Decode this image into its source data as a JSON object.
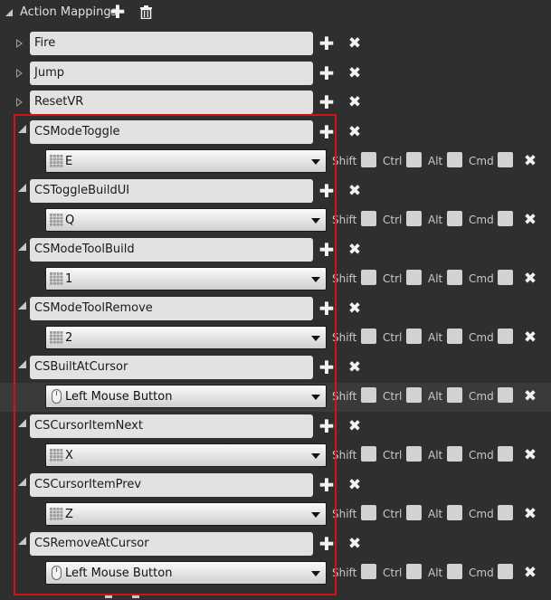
{
  "header": {
    "title": "Action Mappings",
    "add_icon": "plus-icon",
    "delete_icon": "trash-icon"
  },
  "modifier_labels": {
    "shift": "Shift",
    "ctrl": "Ctrl",
    "alt": "Alt",
    "cmd": "Cmd"
  },
  "colors": {
    "background": "#2f2f2f",
    "name_field": "#e2e2e2",
    "highlight_box": "#d0141a"
  },
  "collapsed_mappings": [
    {
      "name": "Fire"
    },
    {
      "name": "Jump"
    },
    {
      "name": "ResetVR"
    }
  ],
  "mappings": [
    {
      "name": "CSModeToggle",
      "key": "E",
      "key_icon": "keyboard-icon"
    },
    {
      "name": "CSToggleBuildUI",
      "key": "Q",
      "key_icon": "keyboard-icon"
    },
    {
      "name": "CSModeToolBuild",
      "key": "1",
      "key_icon": "keyboard-icon"
    },
    {
      "name": "CSModeToolRemove",
      "key": "2",
      "key_icon": "keyboard-icon"
    },
    {
      "name": "CSBuiltAtCursor",
      "key": "Left Mouse Button",
      "key_icon": "mouse-icon"
    },
    {
      "name": "CSCursorItemNext",
      "key": "X",
      "key_icon": "keyboard-icon"
    },
    {
      "name": "CSCursorItemPrev",
      "key": "Z",
      "key_icon": "keyboard-icon"
    },
    {
      "name": "CSRemoveAtCursor",
      "key": "Left Mouse Button",
      "key_icon": "mouse-icon"
    }
  ]
}
